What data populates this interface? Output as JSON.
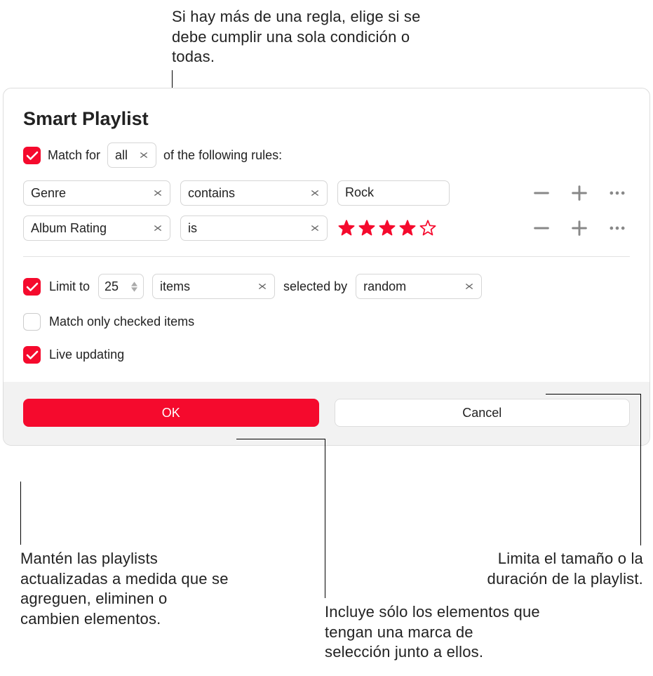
{
  "callouts": {
    "top": "Si hay más de una regla, elige si se debe cumplir una sola condición o todas.",
    "bottom_left": "Mantén las playlists actualizadas a medida que se agreguen, eliminen o cambien elementos.",
    "bottom_middle": "Incluye sólo los elementos que tengan una marca de selección junto a ellos.",
    "bottom_right": "Limita el tamaño o la duración de la playlist."
  },
  "dialog": {
    "title": "Smart Playlist",
    "match": {
      "prefix": "Match for",
      "mode": "all",
      "suffix": "of the following rules:"
    },
    "rules": [
      {
        "field": "Genre",
        "op": "contains",
        "value": "Rock",
        "stars": null
      },
      {
        "field": "Album Rating",
        "op": "is",
        "value": null,
        "stars": 4
      }
    ],
    "limit": {
      "label": "Limit to",
      "count": "25",
      "unit": "items",
      "selected_by_label": "selected by",
      "mode": "random",
      "checked": true
    },
    "match_only_checked": {
      "label": "Match only checked items",
      "checked": false
    },
    "live_updating": {
      "label": "Live updating",
      "checked": true
    },
    "buttons": {
      "ok": "OK",
      "cancel": "Cancel"
    }
  },
  "colors": {
    "accent": "#f50a2d"
  }
}
